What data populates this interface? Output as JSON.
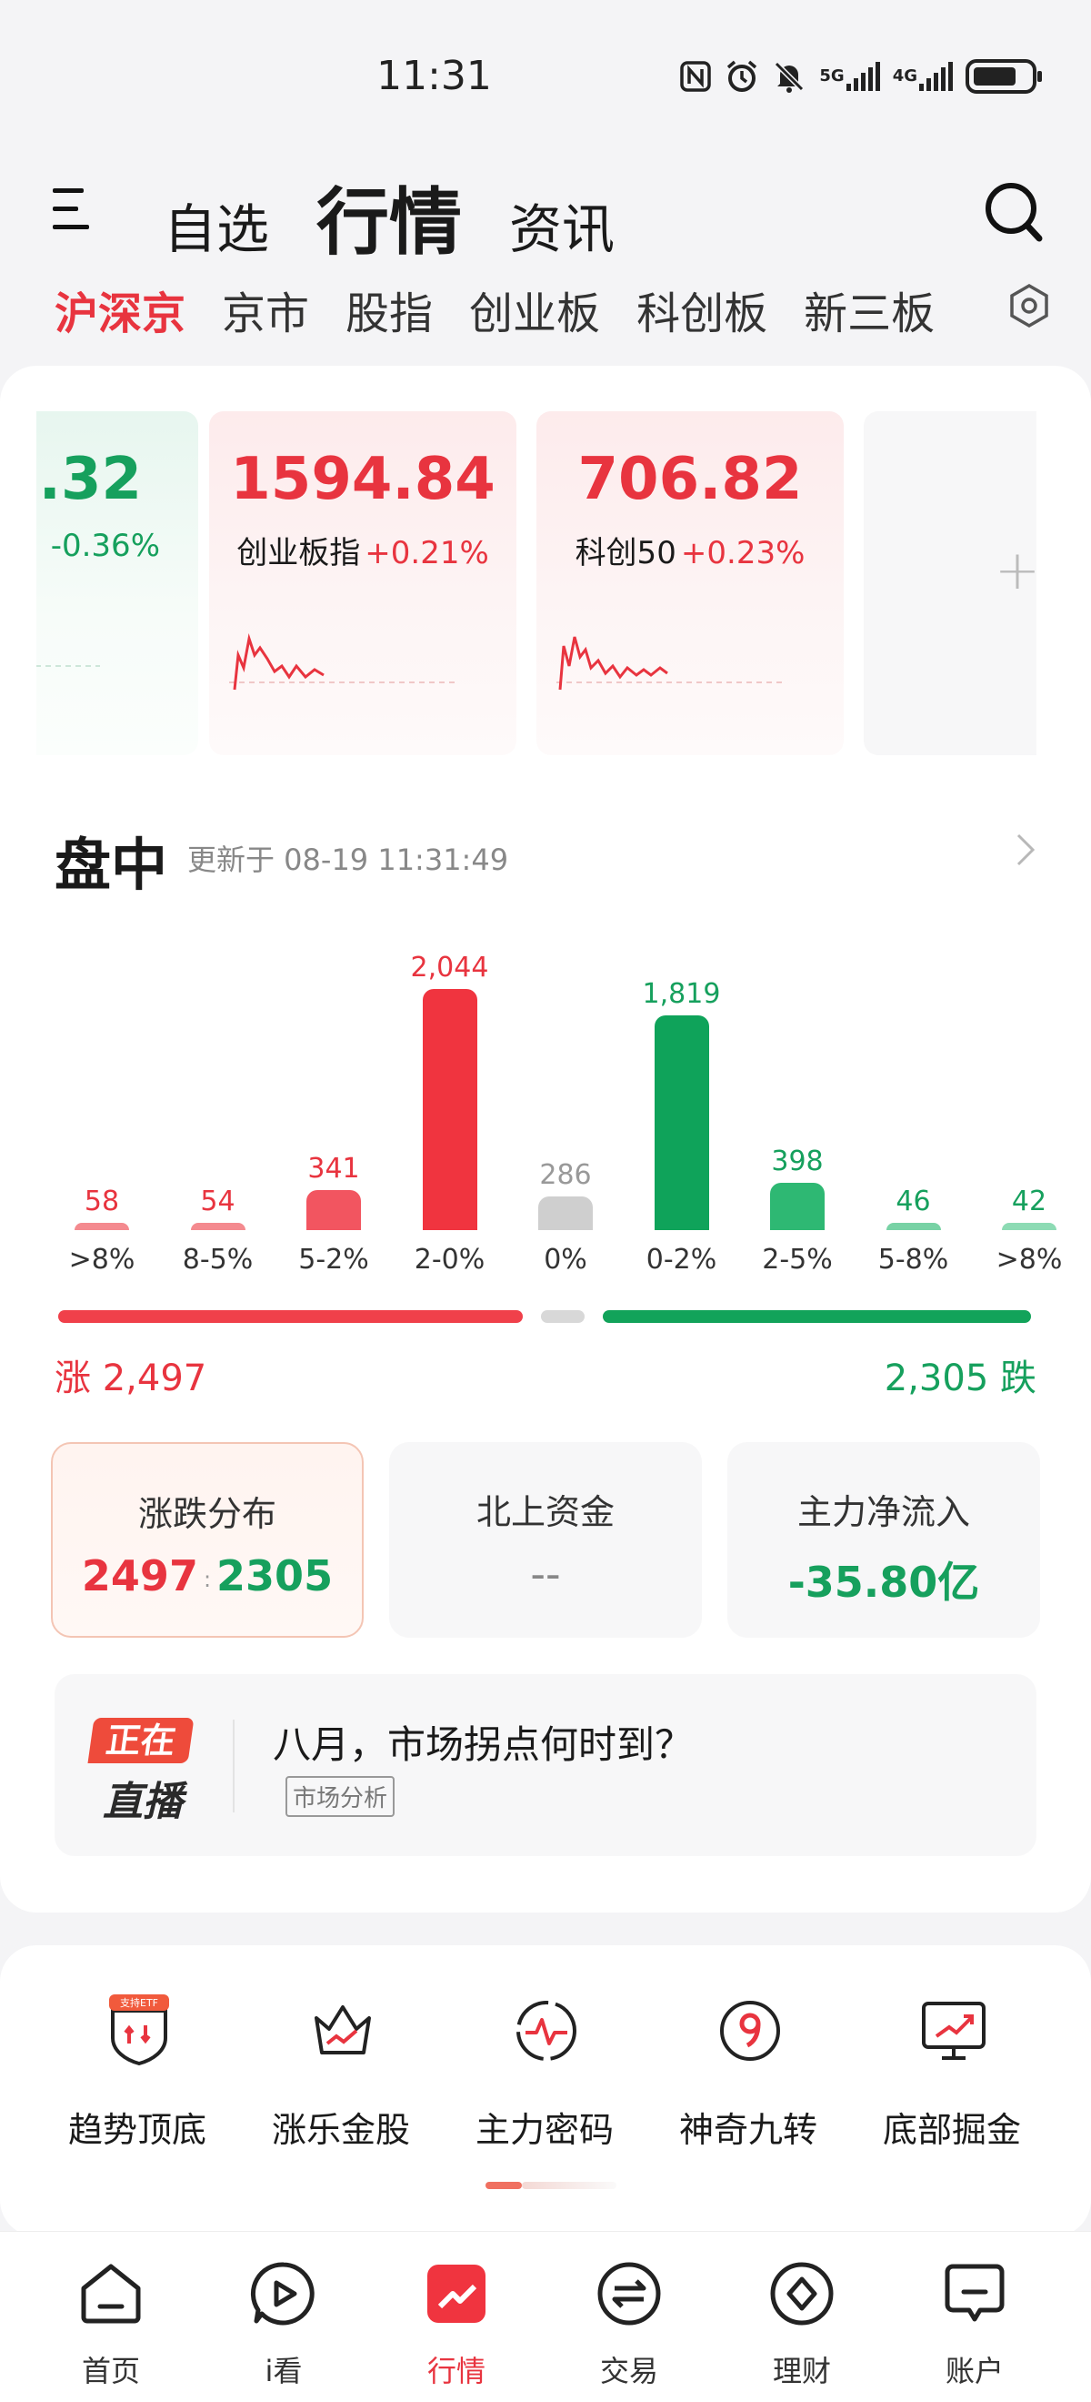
{
  "status_bar": {
    "time": "11:31",
    "net1": "5G",
    "net2": "4G"
  },
  "top_nav": {
    "tabs": [
      {
        "label": "自选",
        "active": false
      },
      {
        "label": "行情",
        "active": true
      },
      {
        "label": "资讯",
        "active": false
      }
    ]
  },
  "sub_tabs": [
    {
      "label": "沪深京",
      "active": true
    },
    {
      "label": "京市",
      "active": false
    },
    {
      "label": "股指",
      "active": false
    },
    {
      "label": "创业板",
      "active": false
    },
    {
      "label": "科创板",
      "active": false
    },
    {
      "label": "新三板",
      "active": false
    }
  ],
  "index_cards": [
    {
      "value": ".32",
      "name": "",
      "change": "-0.36%",
      "trend": "down"
    },
    {
      "value": "1594.84",
      "name": "创业板指",
      "change": "+0.21%",
      "trend": "up"
    },
    {
      "value": "706.82",
      "name": "科创50",
      "change": "+0.23%",
      "trend": "up"
    },
    {
      "value": "+",
      "name": "",
      "change": "",
      "trend": "add"
    }
  ],
  "intraday": {
    "title": "盘中",
    "updated": "更新于 08-19 11:31:49"
  },
  "chart_data": {
    "type": "bar",
    "categories": [
      ">8%",
      "8-5%",
      "5-2%",
      "2-0%",
      "0%",
      "0-2%",
      "2-5%",
      "5-8%",
      ">8%"
    ],
    "values": [
      58,
      54,
      341,
      2044,
      286,
      1819,
      398,
      46,
      42
    ],
    "value_labels": [
      "58",
      "54",
      "341",
      "2,044",
      "286",
      "1,819",
      "398",
      "46",
      "42"
    ],
    "ylim": [
      0,
      2044
    ],
    "colors": [
      "#f48a8f",
      "#f48a8f",
      "#f25560",
      "#f0343f",
      "#cfcfcf",
      "#0fa35a",
      "#2eb873",
      "#78d2a5",
      "#8ddbb4"
    ],
    "label_colors": [
      "#e8343f",
      "#e8343f",
      "#e8343f",
      "#e8343f",
      "#999999",
      "#16a05d",
      "#16a05d",
      "#16a05d",
      "#16a05d"
    ]
  },
  "breadth": {
    "rise_label": "涨 2,497",
    "fall_label": "2,305 跌",
    "rise": 2497,
    "flat": 286,
    "fall": 2305
  },
  "stats": [
    {
      "title": "涨跌分布",
      "up": "2497",
      "down": "2305"
    },
    {
      "title": "北上资金",
      "value": "--"
    },
    {
      "title": "主力净流入",
      "value": "-35.80亿"
    }
  ],
  "live": {
    "badge_top": "正在",
    "badge_bottom": "直播",
    "title": "八月，市场拐点何时到？",
    "tag": "市场分析"
  },
  "tools": [
    {
      "label": "趋势顶底",
      "icon": "shield-icon",
      "badge": "支持ETF"
    },
    {
      "label": "涨乐金股",
      "icon": "crown-icon"
    },
    {
      "label": "主力密码",
      "icon": "pulse-icon"
    },
    {
      "label": "神奇九转",
      "icon": "nine-icon"
    },
    {
      "label": "底部掘金",
      "icon": "monitor-icon"
    }
  ],
  "bottom_nav": [
    {
      "label": "首页",
      "icon": "home-icon",
      "active": false
    },
    {
      "label": "i看",
      "icon": "play-icon",
      "active": false
    },
    {
      "label": "行情",
      "icon": "market-icon",
      "active": true
    },
    {
      "label": "交易",
      "icon": "trade-icon",
      "active": false
    },
    {
      "label": "理财",
      "icon": "wealth-icon",
      "active": false
    },
    {
      "label": "账户",
      "icon": "account-icon",
      "active": false
    }
  ],
  "colors": {
    "up": "#e8343f",
    "down": "#16a05d",
    "accent": "#e8343f"
  }
}
